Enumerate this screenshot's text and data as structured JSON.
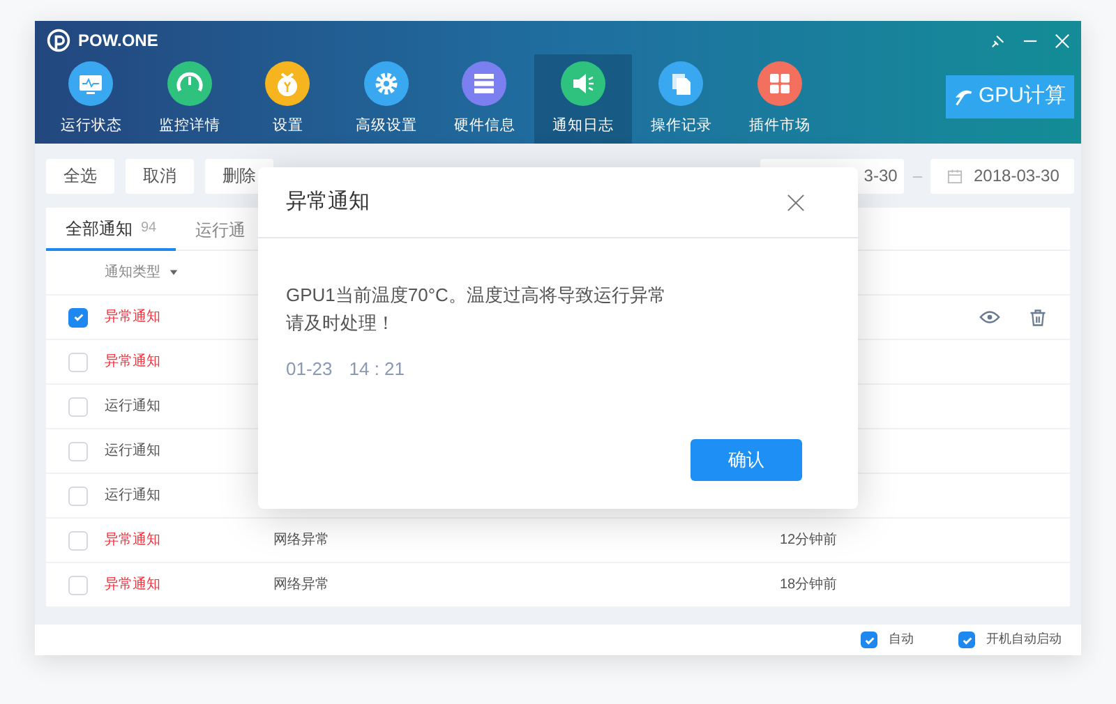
{
  "app": {
    "logo_text": "POW.ONE"
  },
  "nav": [
    {
      "label": "运行状态",
      "color": "#3aa8f0",
      "selected": false
    },
    {
      "label": "监控详情",
      "color": "#2ec27e",
      "selected": false
    },
    {
      "label": "设置",
      "color": "#f6b51e",
      "selected": false
    },
    {
      "label": "高级设置",
      "color": "#3aa8f0",
      "selected": false
    },
    {
      "label": "硬件信息",
      "color": "#7b7ff0",
      "selected": false
    },
    {
      "label": "通知日志",
      "color": "#2ec27e",
      "selected": true
    },
    {
      "label": "操作记录",
      "color": "#3aa8f0",
      "selected": false
    },
    {
      "label": "插件市场",
      "color": "#f36f5e",
      "selected": false
    }
  ],
  "gpu_button": "GPU计算",
  "toolbar": {
    "buttons": [
      "全选",
      "取消",
      "删除"
    ],
    "date_from": "3-30",
    "date_sep": "–",
    "date_to": "2018-03-30"
  },
  "tabs": [
    {
      "label": "全部通知",
      "count": "94",
      "selected": true
    },
    {
      "label": "运行通",
      "selected": false
    }
  ],
  "table": {
    "column_header": "通知类型",
    "rows": [
      {
        "checked": true,
        "kind": "alert",
        "type": "异常通知",
        "actions": true
      },
      {
        "checked": false,
        "kind": "alert",
        "type": "异常通知",
        "actions": false
      },
      {
        "checked": false,
        "kind": "normal",
        "type": "运行通知",
        "actions": false
      },
      {
        "checked": false,
        "kind": "normal",
        "type": "运行通知",
        "actions": false
      },
      {
        "checked": false,
        "kind": "normal",
        "type": "运行通知",
        "actions": false
      },
      {
        "checked": false,
        "kind": "alert",
        "type": "异常通知",
        "content": "网络异常",
        "time": "12分钟前",
        "actions": false
      },
      {
        "checked": false,
        "kind": "alert",
        "type": "异常通知",
        "content": "网络异常",
        "time": "18分钟前",
        "actions": false
      }
    ]
  },
  "footer": [
    {
      "label": "自动",
      "checked": true
    },
    {
      "label": "开机自动启动",
      "checked": true
    }
  ],
  "dialog": {
    "title": "异常通知",
    "message_lines": [
      "GPU1当前温度70°C。温度过高将导致运行异常",
      "请及时处理！"
    ],
    "date": "01-23",
    "time": "14 : 21",
    "confirm": "确认"
  }
}
